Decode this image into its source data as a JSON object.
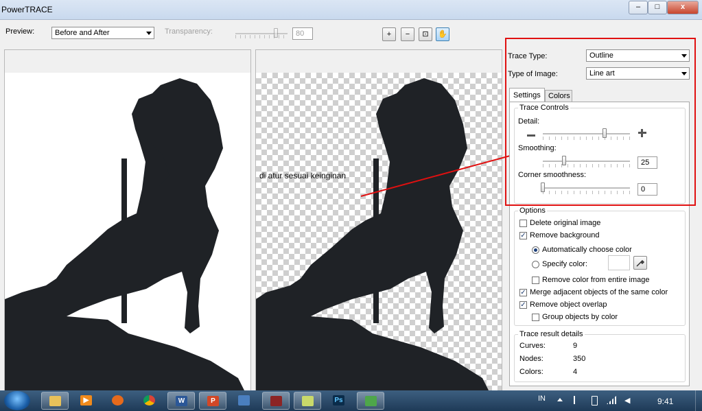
{
  "window": {
    "title": "PowerTRACE",
    "min": "–",
    "max": "□",
    "close": "x"
  },
  "toolbar": {
    "preview_label": "Preview:",
    "preview_value": "Before and After",
    "transparency_label": "Transparency:",
    "transparency_value": "80",
    "zoom_in": "+",
    "zoom_out": "−",
    "fit": "⊡",
    "pan": "✋"
  },
  "annotation": {
    "text": "di atur sesuai keinginan",
    "color": "#e01010"
  },
  "panel": {
    "trace_type_label": "Trace Type:",
    "trace_type_value": "Outline",
    "image_type_label": "Type of Image:",
    "image_type_value": "Line art",
    "tabs": [
      "Settings",
      "Colors"
    ],
    "trace_controls": {
      "title": "Trace Controls",
      "detail_label": "Detail:",
      "detail_level": 0.72,
      "smoothing_label": "Smoothing:",
      "smoothing_value": "25",
      "corner_label": "Corner smoothness:",
      "corner_value": "0"
    },
    "options": {
      "title": "Options",
      "delete_original": "Delete original image",
      "remove_background": "Remove background",
      "auto_color": "Automatically choose color",
      "specify_color": "Specify color:",
      "remove_color_entire": "Remove color from entire image",
      "merge_adjacent": "Merge adjacent objects of the same color",
      "remove_overlap": "Remove object overlap",
      "group_by_color": "Group objects by color"
    },
    "result": {
      "title": "Trace result details",
      "curves_label": "Curves:",
      "curves_value": "9",
      "nodes_label": "Nodes:",
      "nodes_value": "350",
      "colors_label": "Colors:",
      "colors_value": "4"
    }
  },
  "taskbar": {
    "lang": "IN",
    "time": "9:41",
    "apps": [
      "start-orb",
      "explorer",
      "media-player",
      "firefox",
      "chrome",
      "word",
      "powerpoint",
      "network",
      "winrar",
      "window-switch",
      "photoshop",
      "coreldraw"
    ]
  }
}
